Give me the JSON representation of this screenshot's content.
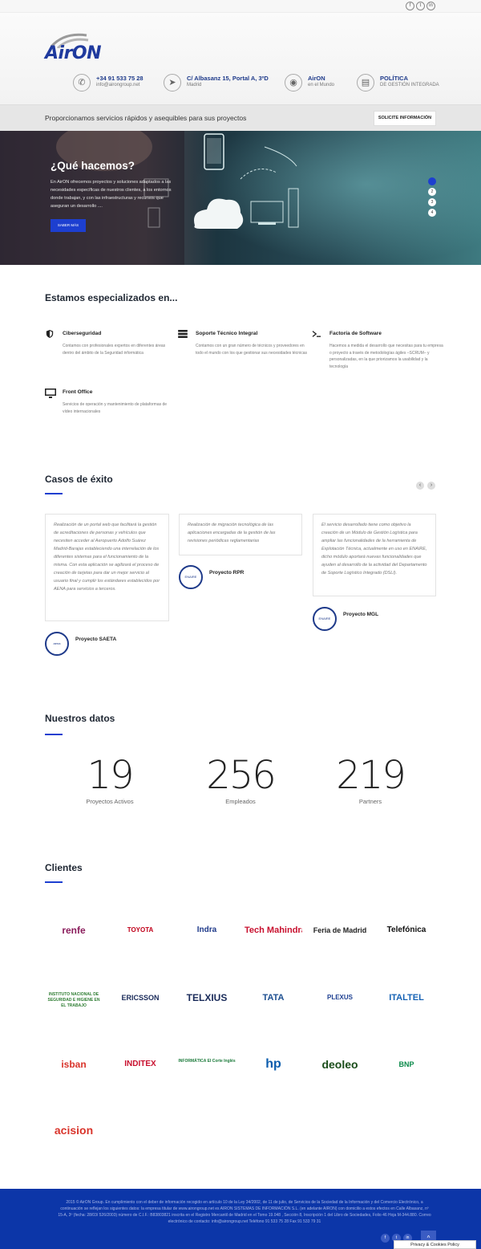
{
  "topbar": {
    "social": [
      "f",
      "t",
      "in"
    ]
  },
  "logo": {
    "text": "AirON"
  },
  "header_info": [
    {
      "icon": "phone-icon",
      "glyph": "✆",
      "line1": "+34 91 533 75 28",
      "line2": "info@airongroup.net"
    },
    {
      "icon": "location-icon",
      "glyph": "➤",
      "line1": "C/ Albasanz 15, Portal A, 3ºD",
      "line2": "Madrid"
    },
    {
      "icon": "globe-icon",
      "glyph": "◉",
      "line1": "AirON",
      "line2": "en el Mundo"
    },
    {
      "icon": "document-icon",
      "glyph": "▤",
      "line1": "POLÍTICA",
      "line2": "DE GESTIÓN INTEGRADA"
    }
  ],
  "tagline": "Proporcionamos servicios rápidos y asequibles para sus proyectos",
  "cta_button": "SOLICITE INFORMACIÓN",
  "hero": {
    "title": "¿Qué hacemos?",
    "description": "En AirON ofrecemos proyectos y soluciones adaptados a las necesidades específicas de nuestros clientes, a los entornos donde trabajan, y con las infraestructuras y recursos que aseguran un desarrollo ....",
    "button": "SABER MÁS",
    "slides": [
      "1",
      "2",
      "3",
      "4"
    ],
    "active_slide": 1
  },
  "specialized": {
    "title": "Estamos especializados en...",
    "items": [
      {
        "icon": "shield-icon",
        "title": "Ciberseguridad",
        "desc": "Contamos con profesionales expertos en diferentes áreas dentro del ámbito de la Seguridad informática"
      },
      {
        "icon": "server-icon",
        "title": "Soporte Técnico Integral",
        "desc": "Contamos con un gran número de técnicos y proveedores en todo el mundo con los que gestionar sus necesidades técnicas"
      },
      {
        "icon": "terminal-icon",
        "title": "Factoría de Software",
        "desc": "Hacemos a medida el desarrollo que necesitas para tu empresa o proyecto a través de metodologías ágiles –SCRUM– y personalizadas, en la que priorizamos la usabilidad y la tecnología"
      },
      {
        "icon": "monitor-icon",
        "title": "Front Office",
        "desc": "Servicios de operación y mantenimiento de plataformas de vídeo internacionales"
      }
    ]
  },
  "cases": {
    "title": "Casos de éxito",
    "items": [
      {
        "text": "Realización de un portal web que facilitará la gestión de acreditaciones de personas y vehículos que necesiten acceder al Aeropuerto Adolfo Suárez Madrid-Barajas estableciendo una interrelación de los diferentes sistemas para el funcionamiento de la misma. Con esta aplicación se agilizará el proceso de creación de tarjetas para dar un mejor servicio al usuario final y cumplir los estándares establecidos por AENA para servicios a terceros.",
        "name": "Proyecto SAETA",
        "logo": "aena"
      },
      {
        "text": "Realización de migración tecnológica de las aplicaciones encargadas de la gestión de las revisiones periódicas reglamentarias",
        "name": "Proyecto RPR",
        "logo": "ENAIRE"
      },
      {
        "text": "El servicio desarrollado tiene como objetivo la creación de un Módulo de Gestión Logística para ampliar las funcionalidades de la herramienta de Explotación Técnica, actualmente en uso en ENAIRE, dicho módulo aportará nuevas funcionalidades que ayuden al desarrollo de la actividad del Departamento de Soporte Logístico Integrado (DSLI).",
        "name": "Proyecto MGL",
        "logo": "ENAIRE"
      }
    ]
  },
  "stats": {
    "title": "Nuestros datos",
    "items": [
      {
        "value": "19",
        "label": "Proyectos Activos"
      },
      {
        "value": "256",
        "label": "Empleados"
      },
      {
        "value": "219",
        "label": "Partners"
      }
    ]
  },
  "clients": {
    "title": "Clientes",
    "logos": [
      {
        "name": "renfe",
        "color": "#8a1d5c"
      },
      {
        "name": "TOYOTA",
        "color": "#c0001a"
      },
      {
        "name": "Indra",
        "color": "#1f3a8a"
      },
      {
        "name": "Tech Mahindra",
        "color": "#c8102e"
      },
      {
        "name": "Feria de Madrid",
        "color": "#222222"
      },
      {
        "name": "Telefónica",
        "color": "#111111"
      },
      {
        "name": "INSTITUTO NACIONAL DE SEGURIDAD E HIGIENE EN EL TRABAJO",
        "color": "#2e7d32"
      },
      {
        "name": "ERICSSON",
        "color": "#1a2b5a"
      },
      {
        "name": "TELXIUS",
        "color": "#1a2b5a"
      },
      {
        "name": "TATA",
        "color": "#1d4f91"
      },
      {
        "name": "PLEXUS",
        "color": "#1d3f91"
      },
      {
        "name": "ITALTEL",
        "color": "#1763b5"
      },
      {
        "name": "isban",
        "color": "#d9342b"
      },
      {
        "name": "INDITEX",
        "color": "#c8102e"
      },
      {
        "name": "INFORMÁTICA El Corte Inglés",
        "color": "#1b7a3a"
      },
      {
        "name": "hp",
        "color": "#0a5cad"
      },
      {
        "name": "deoleo",
        "color": "#1a4d1a"
      },
      {
        "name": "BNP",
        "color": "#0b8a4a"
      },
      {
        "name": "acision",
        "color": "#d9342b"
      }
    ]
  },
  "footer": {
    "text": "2015 © AirON Group. En cumplimiento con el deber de información recogido en artículo 10 de la Ley 34/2002, de 11 de julio, de Servicios de la Sociedad de la Información y del Comercio Electrónico, a continuación se reflejan los siguientes datos: la empresa titular de www.airongroup.net es AIRON SISTEMAS DE INFORMACIÓN S.L. (en adelante AIRON) con domicilio a estos efectos en Calle Albasanz, nº 15-A, 3º (fecha: 28/03/ 526/2003) número de C.I.F.: B83803821 inscrita en el Registro Mercantil de Madrid en el Tomo 19.048 , Sección 8, Inscripción 1 del Libro de Sociedades, Folio 46 Hoja M-344.880. Correo electrónico de contacto: info@airongroup.net Teléfono 91 533 75 28 Fax 91 533 79 31",
    "social": [
      "f",
      "t",
      "in"
    ],
    "to_top": "^"
  },
  "cookie": "Privacy & Cookies Policy"
}
